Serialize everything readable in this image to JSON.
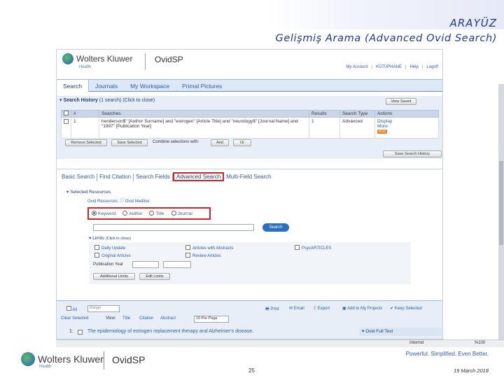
{
  "slide": {
    "title": "ARAYÜZ",
    "subtitle": "Gelişmiş Arama (Advanced Ovid Search)",
    "page_number": "25",
    "date": "19 March 2018",
    "tagline": "Powerful. Simplified. Even Better."
  },
  "header": {
    "brand": "Wolters Kluwer",
    "brand_sub": "Health",
    "product": "OvidSP",
    "links": [
      "My Account",
      "KÜTÜPHANE",
      "Help",
      "Logoff"
    ]
  },
  "tabs": [
    "Search",
    "Journals",
    "My Workspace",
    "Primal Pictures"
  ],
  "history": {
    "heading": "Search History",
    "count": "(1 search)",
    "toggle": "(Click to close)",
    "view_saved": "View Saved",
    "columns": [
      "Searches",
      "Results",
      "Search Type",
      "Actions"
    ],
    "row": {
      "num": "1",
      "query": "henderson$\" [Author Surname] and \"estrogen\" [Article Title] and \"neurology$\" [Journal Name] and \"1997\" [Publication Year]",
      "results": "1",
      "type": "Advanced",
      "actions": [
        "Display",
        "More"
      ]
    },
    "remove_label": "Remove Selected",
    "save_label": "Save Selected",
    "combine_label": "Combine selections with:",
    "and": "And",
    "or": "Or",
    "rss": "RSS",
    "save_history": "Save Search History"
  },
  "search_tabs": [
    "Basic Search",
    "Find Citation",
    "Search Fields",
    "Advanced Search",
    "Multi-Field Search"
  ],
  "resources": {
    "heading": "Selected Resources",
    "ovid_resources": "Ovid Resources:",
    "db": "Ovid Medline",
    "options": [
      "Keyword",
      "Author",
      "Title",
      "Journal"
    ],
    "search_button": "Search"
  },
  "limits": {
    "heading": "Limits",
    "toggle": "(Click to close)",
    "items": [
      "Daily Update",
      "Articles with Abstracts",
      "PsycARTICLES",
      "Original Articles",
      "Review Articles"
    ],
    "pub_year": "Publication Year",
    "additional": "Additional Limits",
    "edit": "Edit Limits"
  },
  "results": {
    "all": "All",
    "range": "Range",
    "tools": [
      "Print",
      "Email",
      "Export",
      "Add to My Projects",
      "Keep Selected"
    ],
    "clear": "Clear Selected",
    "view": "View:",
    "views": [
      "Title",
      "Citation",
      "Abstract"
    ],
    "per_page": "10 Per Page",
    "first_title": "The epidemiology of estrogen replacement therapy and Alzheimer's disease.",
    "fulltext": "Ovid Full Text"
  },
  "status": {
    "left": "Internet",
    "zoom": "%100"
  }
}
